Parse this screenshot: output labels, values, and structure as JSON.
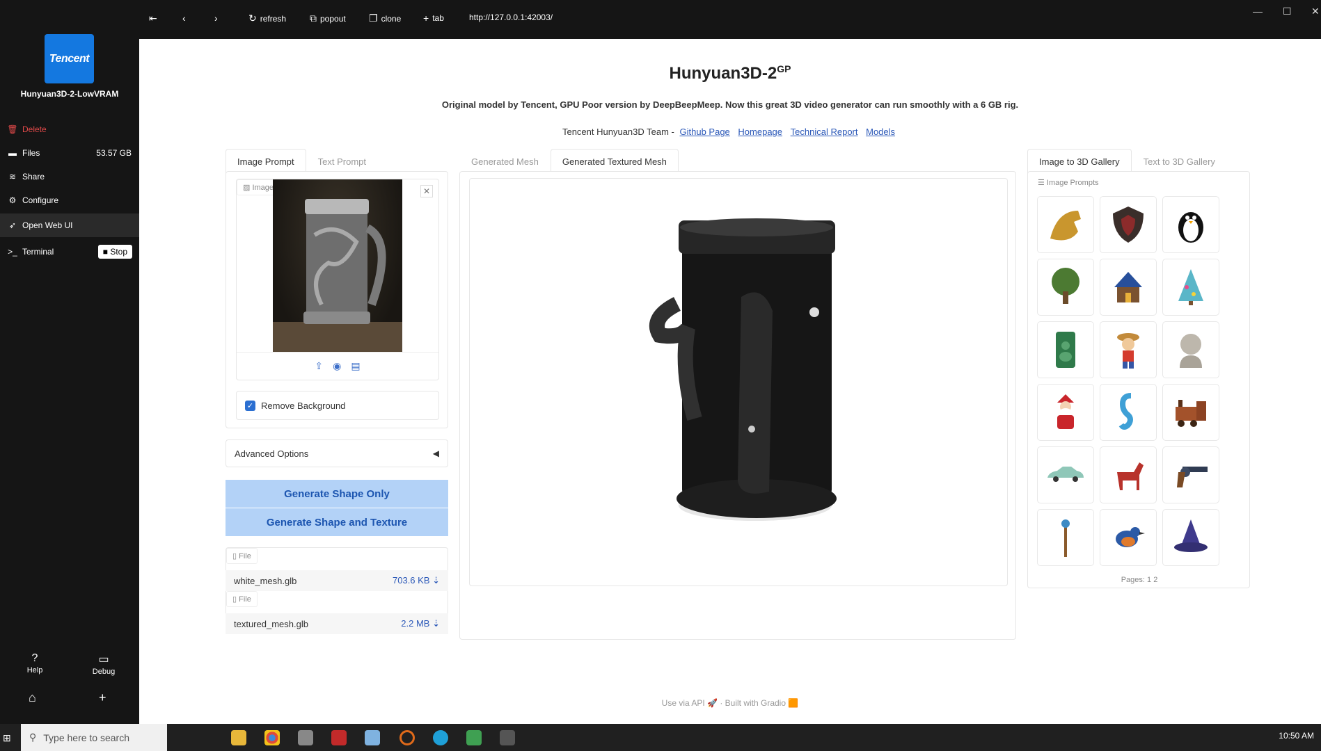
{
  "sidebar": {
    "logo_text": "Tencent",
    "app_name": "Hunyuan3D-2-LowVRAM",
    "items": [
      {
        "label": "Delete"
      },
      {
        "label": "Files",
        "extra": "53.57 GB"
      },
      {
        "label": "Share"
      },
      {
        "label": "Configure"
      },
      {
        "label": "Open Web UI"
      },
      {
        "label": "Terminal",
        "button": "Stop"
      }
    ],
    "help_label": "Help",
    "debug_label": "Debug"
  },
  "topbar": {
    "refresh": "refresh",
    "popout": "popout",
    "clone": "clone",
    "tab": "tab",
    "url": "http://127.0.0.1:42003/"
  },
  "header": {
    "title": "Hunyuan3D-2",
    "title_sup": "GP",
    "subtitle": "Original model by Tencent, GPU Poor version by DeepBeepMeep. Now this great 3D video generator can run smoothly with a 6 GB rig.",
    "team_prefix": "Tencent Hunyuan3D Team -",
    "links": [
      "Github Page",
      "Homepage",
      "Technical Report",
      "Models"
    ]
  },
  "left_panel": {
    "tabs": [
      "Image Prompt",
      "Text Prompt"
    ],
    "image_tag": "Image",
    "remove_bg_label": "Remove Background",
    "remove_bg_checked": true,
    "advanced_label": "Advanced Options",
    "btn_shape": "Generate Shape Only",
    "btn_texture": "Generate Shape and Texture",
    "file_tag": "File",
    "files": [
      {
        "name": "white_mesh.glb",
        "size": "703.6 KB ⇣"
      },
      {
        "name": "textured_mesh.glb",
        "size": "2.2 MB ⇣"
      }
    ]
  },
  "center_panel": {
    "tabs": [
      "Generated Mesh",
      "Generated Textured Mesh"
    ]
  },
  "gallery": {
    "tabs": [
      "Image to 3D Gallery",
      "Text to 3D Gallery"
    ],
    "label": "Image Prompts",
    "items": [
      "dragon",
      "shield",
      "penguin",
      "tree",
      "house",
      "christmas-tree",
      "buddha",
      "pirate",
      "bust",
      "santa",
      "seahorse",
      "train",
      "car",
      "horse",
      "revolver",
      "staff",
      "bird",
      "wizard-hat"
    ],
    "pages_label": "Pages:",
    "pages": [
      "1",
      "2"
    ]
  },
  "footer": {
    "api": "Use via API",
    "sep": "·",
    "built": "Built with Gradio"
  },
  "taskbar": {
    "search_placeholder": "Type here to search",
    "clock": "10:50 AM"
  }
}
